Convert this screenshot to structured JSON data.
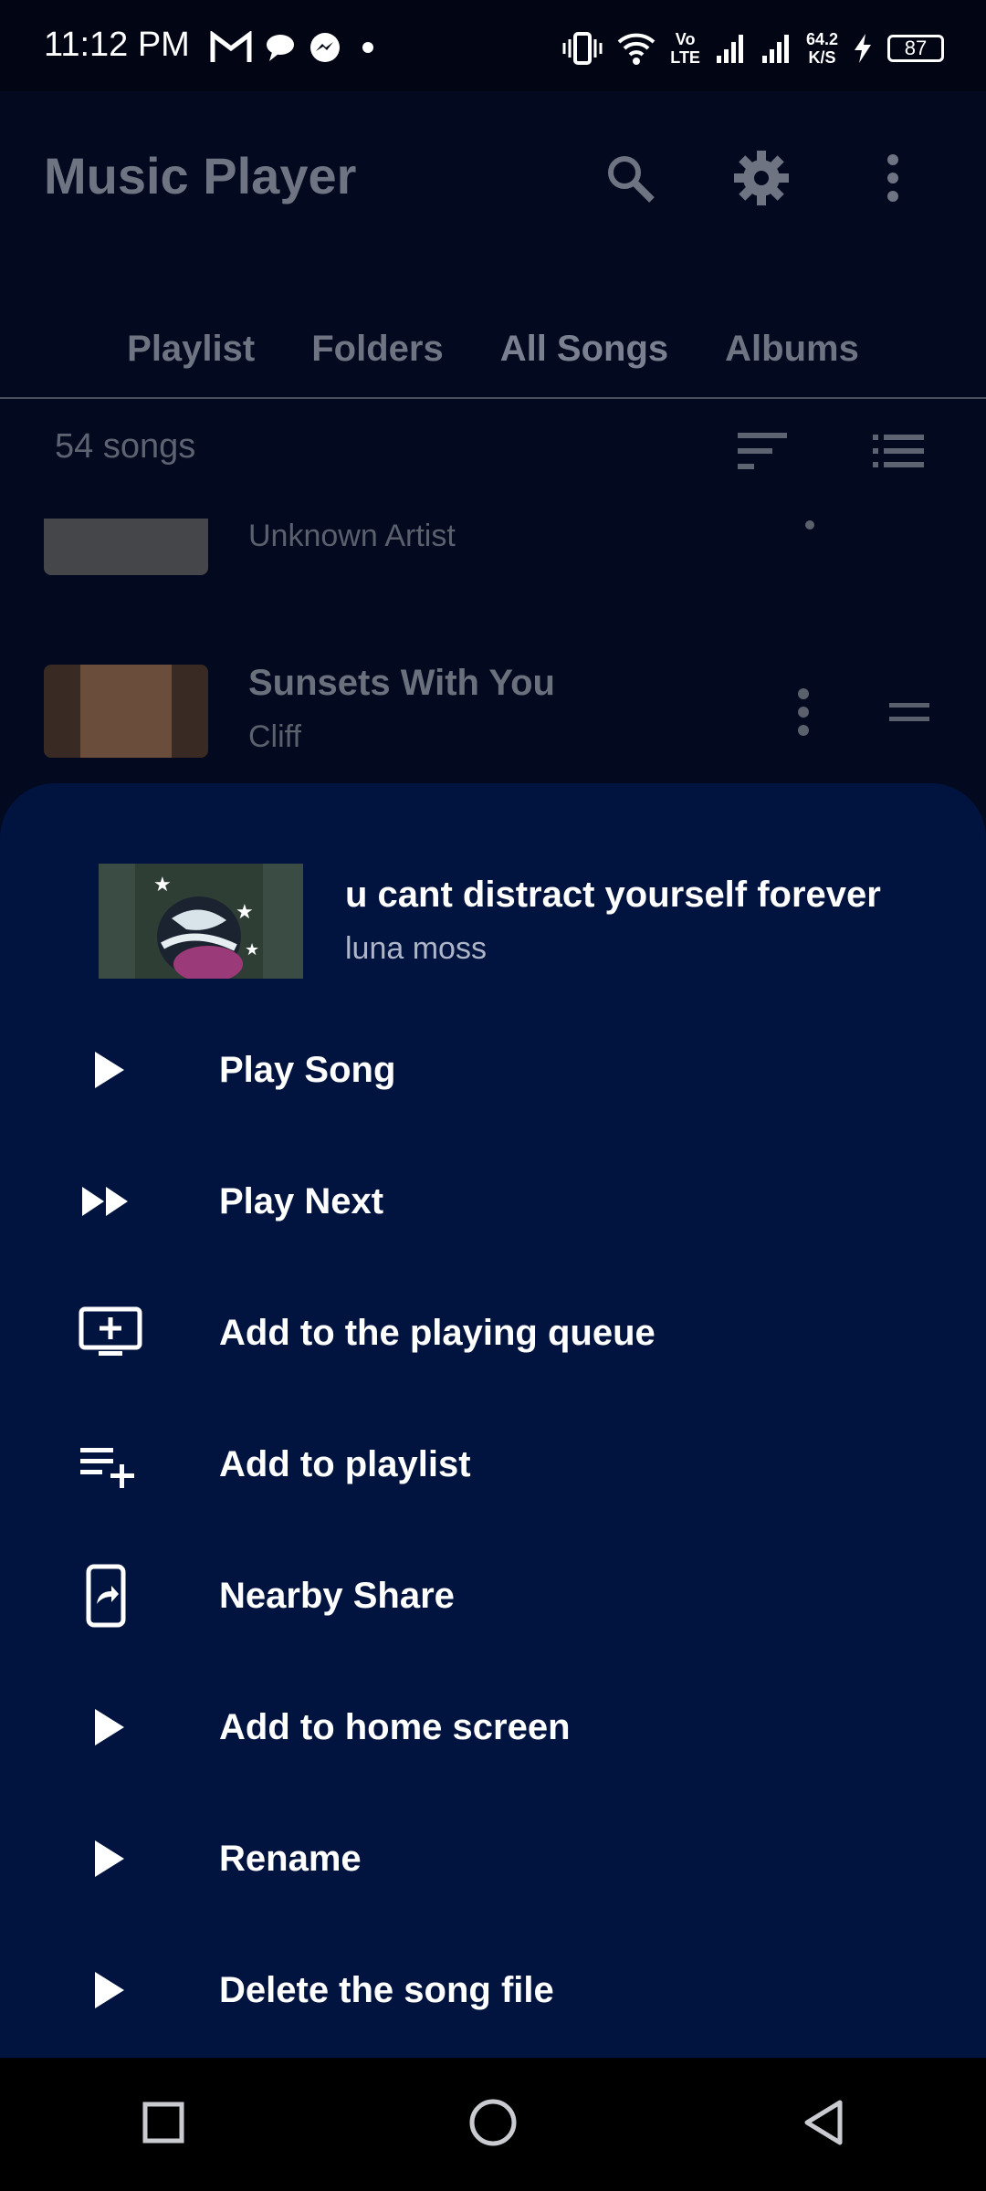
{
  "status_bar": {
    "time": "11:12 PM",
    "net_speed_value": "64.2",
    "net_speed_unit": "K/S",
    "battery": "87",
    "volte_top": "Vo",
    "volte_bottom": "LTE"
  },
  "app": {
    "title": "Music Player",
    "tabs": [
      {
        "label": "Playlist"
      },
      {
        "label": "Folders"
      },
      {
        "label": "All Songs"
      },
      {
        "label": "Albums"
      }
    ],
    "song_count": "54 songs"
  },
  "list": [
    {
      "title": "",
      "artist": "Unknown Artist"
    },
    {
      "title": "Sunsets With You",
      "artist": "Cliff"
    }
  ],
  "sheet": {
    "song_title": "u cant distract yourself forever",
    "song_artist": "luna moss",
    "actions": [
      {
        "label": "Play Song",
        "icon": "play-icon"
      },
      {
        "label": "Play Next",
        "icon": "fast-forward-icon"
      },
      {
        "label": "Add to the playing queue",
        "icon": "add-to-queue-icon"
      },
      {
        "label": "Add to playlist",
        "icon": "playlist-add-icon"
      },
      {
        "label": "Nearby Share",
        "icon": "nearby-share-icon"
      },
      {
        "label": "Add to home screen",
        "icon": "play-icon"
      },
      {
        "label": "Rename",
        "icon": "play-icon"
      },
      {
        "label": "Delete the song file",
        "icon": "play-icon"
      }
    ]
  },
  "colors": {
    "sheet_background": "#011440",
    "page_background": "#03091f",
    "muted_text": "#6f7482"
  }
}
